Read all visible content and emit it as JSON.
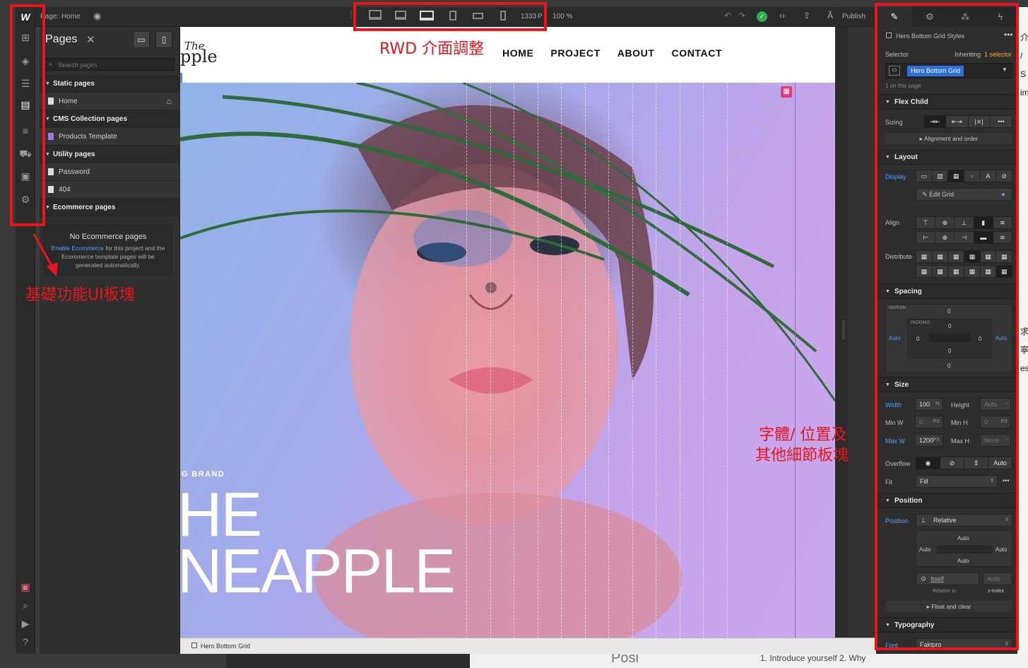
{
  "topbar": {
    "page_prefix": "Page:",
    "page_name": "Home",
    "width": "1333",
    "width_unit": "PX",
    "zoom": "100 %",
    "publish": "Publish"
  },
  "pages_panel": {
    "title": "Pages",
    "search_placeholder": "Search pages",
    "rows": [
      {
        "kind": "section",
        "label": "Static pages"
      },
      {
        "kind": "item",
        "label": "Home"
      },
      {
        "kind": "section",
        "label": "CMS Collection pages"
      },
      {
        "kind": "item",
        "label": "Products Template"
      },
      {
        "kind": "section",
        "label": "Utility pages"
      },
      {
        "kind": "item",
        "label": "Password"
      },
      {
        "kind": "item",
        "label": "404"
      },
      {
        "kind": "section",
        "label": "Ecommerce pages"
      }
    ],
    "ecom_title": "No Ecommerce pages",
    "ecom_link": "Enable Ecommerce",
    "ecom_text": " for this project and the Ecommerce template pages will be generated automatically."
  },
  "site": {
    "logo_top": "The",
    "logo_bottom": "pple",
    "nav": [
      "HOME",
      "PROJECT",
      "ABOUT",
      "CONTACT"
    ],
    "brand_small": "G BRAND",
    "headline_1": "HE",
    "headline_2": "NEAPPLE"
  },
  "breadcrumb": "Hero Bottom Grid",
  "style_panel": {
    "header": "Hero Bottom Grid Styles",
    "selector_label": "Selector",
    "inheriting": "Inheriting",
    "inheriting_link": "1 selector",
    "selector_value": "Hero Bottom Grid",
    "on_page": "1 on this page",
    "flex_child": "Flex Child",
    "sizing": "Sizing",
    "align_order": "Alignment and order",
    "layout": "Layout",
    "display": "Display",
    "edit_grid": "Edit Grid",
    "align": "Align",
    "distribute": "Distribute",
    "spacing": "Spacing",
    "margin": "MARGIN",
    "padding": "PADDING",
    "zero": "0",
    "auto": "Auto",
    "size": "Size",
    "width_label": "Width",
    "width_value": "100",
    "width_unit": "%",
    "height_label": "Height",
    "height_value": "Auto",
    "minw_label": "Min W",
    "minw_value": "0",
    "minh_label": "Min H",
    "minh_value": "0",
    "maxw_label": "Max W",
    "maxw_value": "1200",
    "maxh_label": "Max H",
    "maxh_value": "None",
    "px": "PX",
    "overflow": "Overflow",
    "overflow_auto": "Auto",
    "fit": "Fit",
    "fit_value": "Fill",
    "position": "Position",
    "position_value": "Relative",
    "itself": "Itself",
    "relative_to": "Relative to",
    "zindex": "z-Index",
    "float_clear": "Float and clear",
    "typography": "Typography",
    "font": "Font",
    "font_value": "Faktpro"
  },
  "annotations": {
    "rwd": "RWD 介面調整",
    "basic": "基礎功能UI板塊",
    "detail_1": "字體/ 位置及",
    "detail_2": "其他細節板塊"
  },
  "background": {
    "posi": "Posi",
    "text": "1. Introduce yourself 2. Why"
  }
}
